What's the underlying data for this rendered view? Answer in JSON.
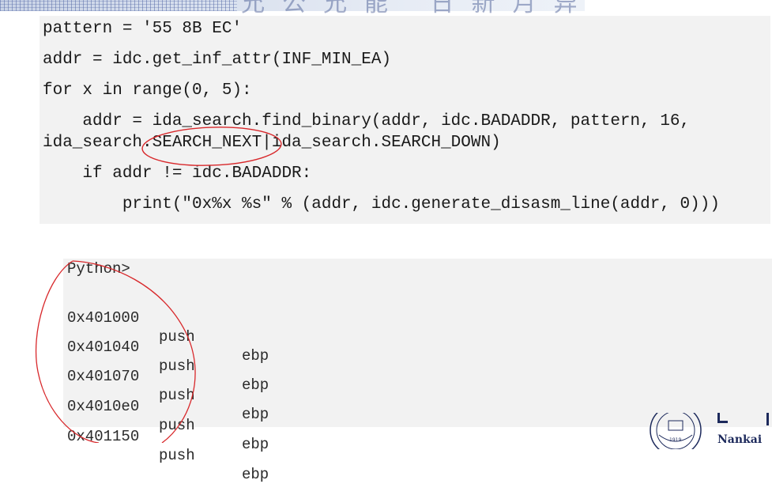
{
  "banner": {
    "motto": "允公允能 日新月异"
  },
  "code": {
    "lines": [
      "pattern = '55 8B EC'",
      "addr = idc.get_inf_attr(INF_MIN_EA)",
      "for x in range(0, 5):",
      "    addr = ida_search.find_binary(addr, idc.BADADDR, pattern, 16,",
      "ida_search.SEARCH_NEXT|ida_search.SEARCH_DOWN)",
      "    if addr != idc.BADADDR:",
      "        print(\"0x%x %s\" % (addr, idc.generate_disasm_line(addr, 0)))"
    ]
  },
  "output": {
    "prompt": "Python>",
    "rows": [
      {
        "addr": "0x401000",
        "op": "push",
        "arg": "ebp"
      },
      {
        "addr": "0x401040",
        "op": "push",
        "arg": "ebp"
      },
      {
        "addr": "0x401070",
        "op": "push",
        "arg": "ebp"
      },
      {
        "addr": "0x4010e0",
        "op": "push",
        "arg": "ebp"
      },
      {
        "addr": "0x401150",
        "op": "push",
        "arg": "ebp"
      }
    ]
  },
  "logo": {
    "text": "Nankai",
    "seal_year": "1919"
  },
  "colors": {
    "annotation": "#d8282b",
    "code_bg": "#f2f2f2",
    "logo": "#1d2a5c"
  },
  "icons": [
    "university-seal-icon"
  ]
}
